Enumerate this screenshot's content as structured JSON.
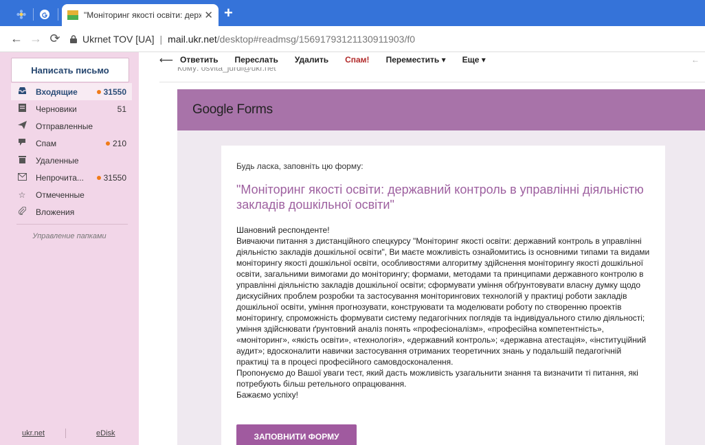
{
  "browser": {
    "active_tab_title": "\"Моніторинг якості освіти: держ",
    "site_identity": "Ukrnet TOV [UA]",
    "url_host": "mail.ukr.net",
    "url_path": "/desktop#readmsg/15691793121130911903/f0",
    "accent_color": "#3573d9"
  },
  "sidebar": {
    "compose_label": "Написать письмо",
    "folders": [
      {
        "label": "Входящие",
        "count": "31550",
        "icon": "inbox-icon",
        "unread_dot": true
      },
      {
        "label": "Черновики",
        "count": "51",
        "icon": "drafts-icon",
        "unread_dot": false
      },
      {
        "label": "Отправленные",
        "count": "",
        "icon": "sent-icon",
        "unread_dot": false
      },
      {
        "label": "Спам",
        "count": "210",
        "icon": "spam-icon",
        "unread_dot": true
      },
      {
        "label": "Удаленные",
        "count": "",
        "icon": "trash-icon",
        "unread_dot": false
      },
      {
        "label": "Непрочита...",
        "count": "31550",
        "icon": "unread-icon",
        "unread_dot": true
      },
      {
        "label": "Отмеченные",
        "count": "",
        "icon": "star-icon",
        "unread_dot": false
      },
      {
        "label": "Вложения",
        "count": "",
        "icon": "attachment-icon",
        "unread_dot": false
      }
    ],
    "manage_label": "Управление папками",
    "footer": {
      "link1": "ukr.net",
      "link2": "eDisk"
    },
    "background_color": "#f2d6e8"
  },
  "toolbar": {
    "reply": "Ответить",
    "forward": "Переслать",
    "delete": "Удалить",
    "spam": "Спам!",
    "move": "Переместить ▾",
    "more": "Еще ▾"
  },
  "message": {
    "header_cut": "Кому: osvita_jurdi@ukr.net",
    "form_logo_brand": "Google",
    "form_logo_product": "Forms",
    "intro": "Будь ласка, заповніть цю форму:",
    "title": "\"Моніторинг якості освіти: державний контроль в управлінні діяльністю закладів дошкільної освіти\"",
    "greeting": "Шановний респонденте!",
    "body": "Вивчаючи питання з дистанційного спецкурсу \"Моніторинг якості освіти: державний контроль в управлінні діяльністю закладів дошкільної освіти\", Ви маєте можливість ознайомитись із основними типами та видами моніторингу якості дошкільної освіти, особливостями алгоритму здійснення моніторингу якості дошкільної освіти, загальними вимогами до моніторингу; формами, методами та принципами державного контролю в управлінні діяльністю закладів дошкільної освіти; сформувати уміння обґрунтовувати власну думку щодо дискусійних проблем розробки та застосування моніторингових технологій у практиці роботи закладів дошкільної освіти, уміння прогнозувати, конструювати та моделювати роботу по створенню проектів моніторингу, спроможність формувати систему педагогічних поглядів та індивідуального стилю діяльності; уміння здійснювати ґрунтовний аналіз понять «професіоналізм», «професійна компетентність», «моніторинг», «якість освіти», «технологія», «державний контроль»; «державна атестація», «інституційний аудит»; вдосконалити навички застосування отриманих теоретичних знань у подальшій педагогічній практиці та в процесі професійного самовдосконалення.",
    "offer": "Пропонуємо до Вашої уваги тест, який дасть можливість узагальнити знання та визначити ті питання, які потребують більш ретельного опрацювання.",
    "wish": "Бажаємо успіху!",
    "button_label": "ЗАПОВНИТИ ФОРМУ",
    "form_color": "#a873a9"
  }
}
